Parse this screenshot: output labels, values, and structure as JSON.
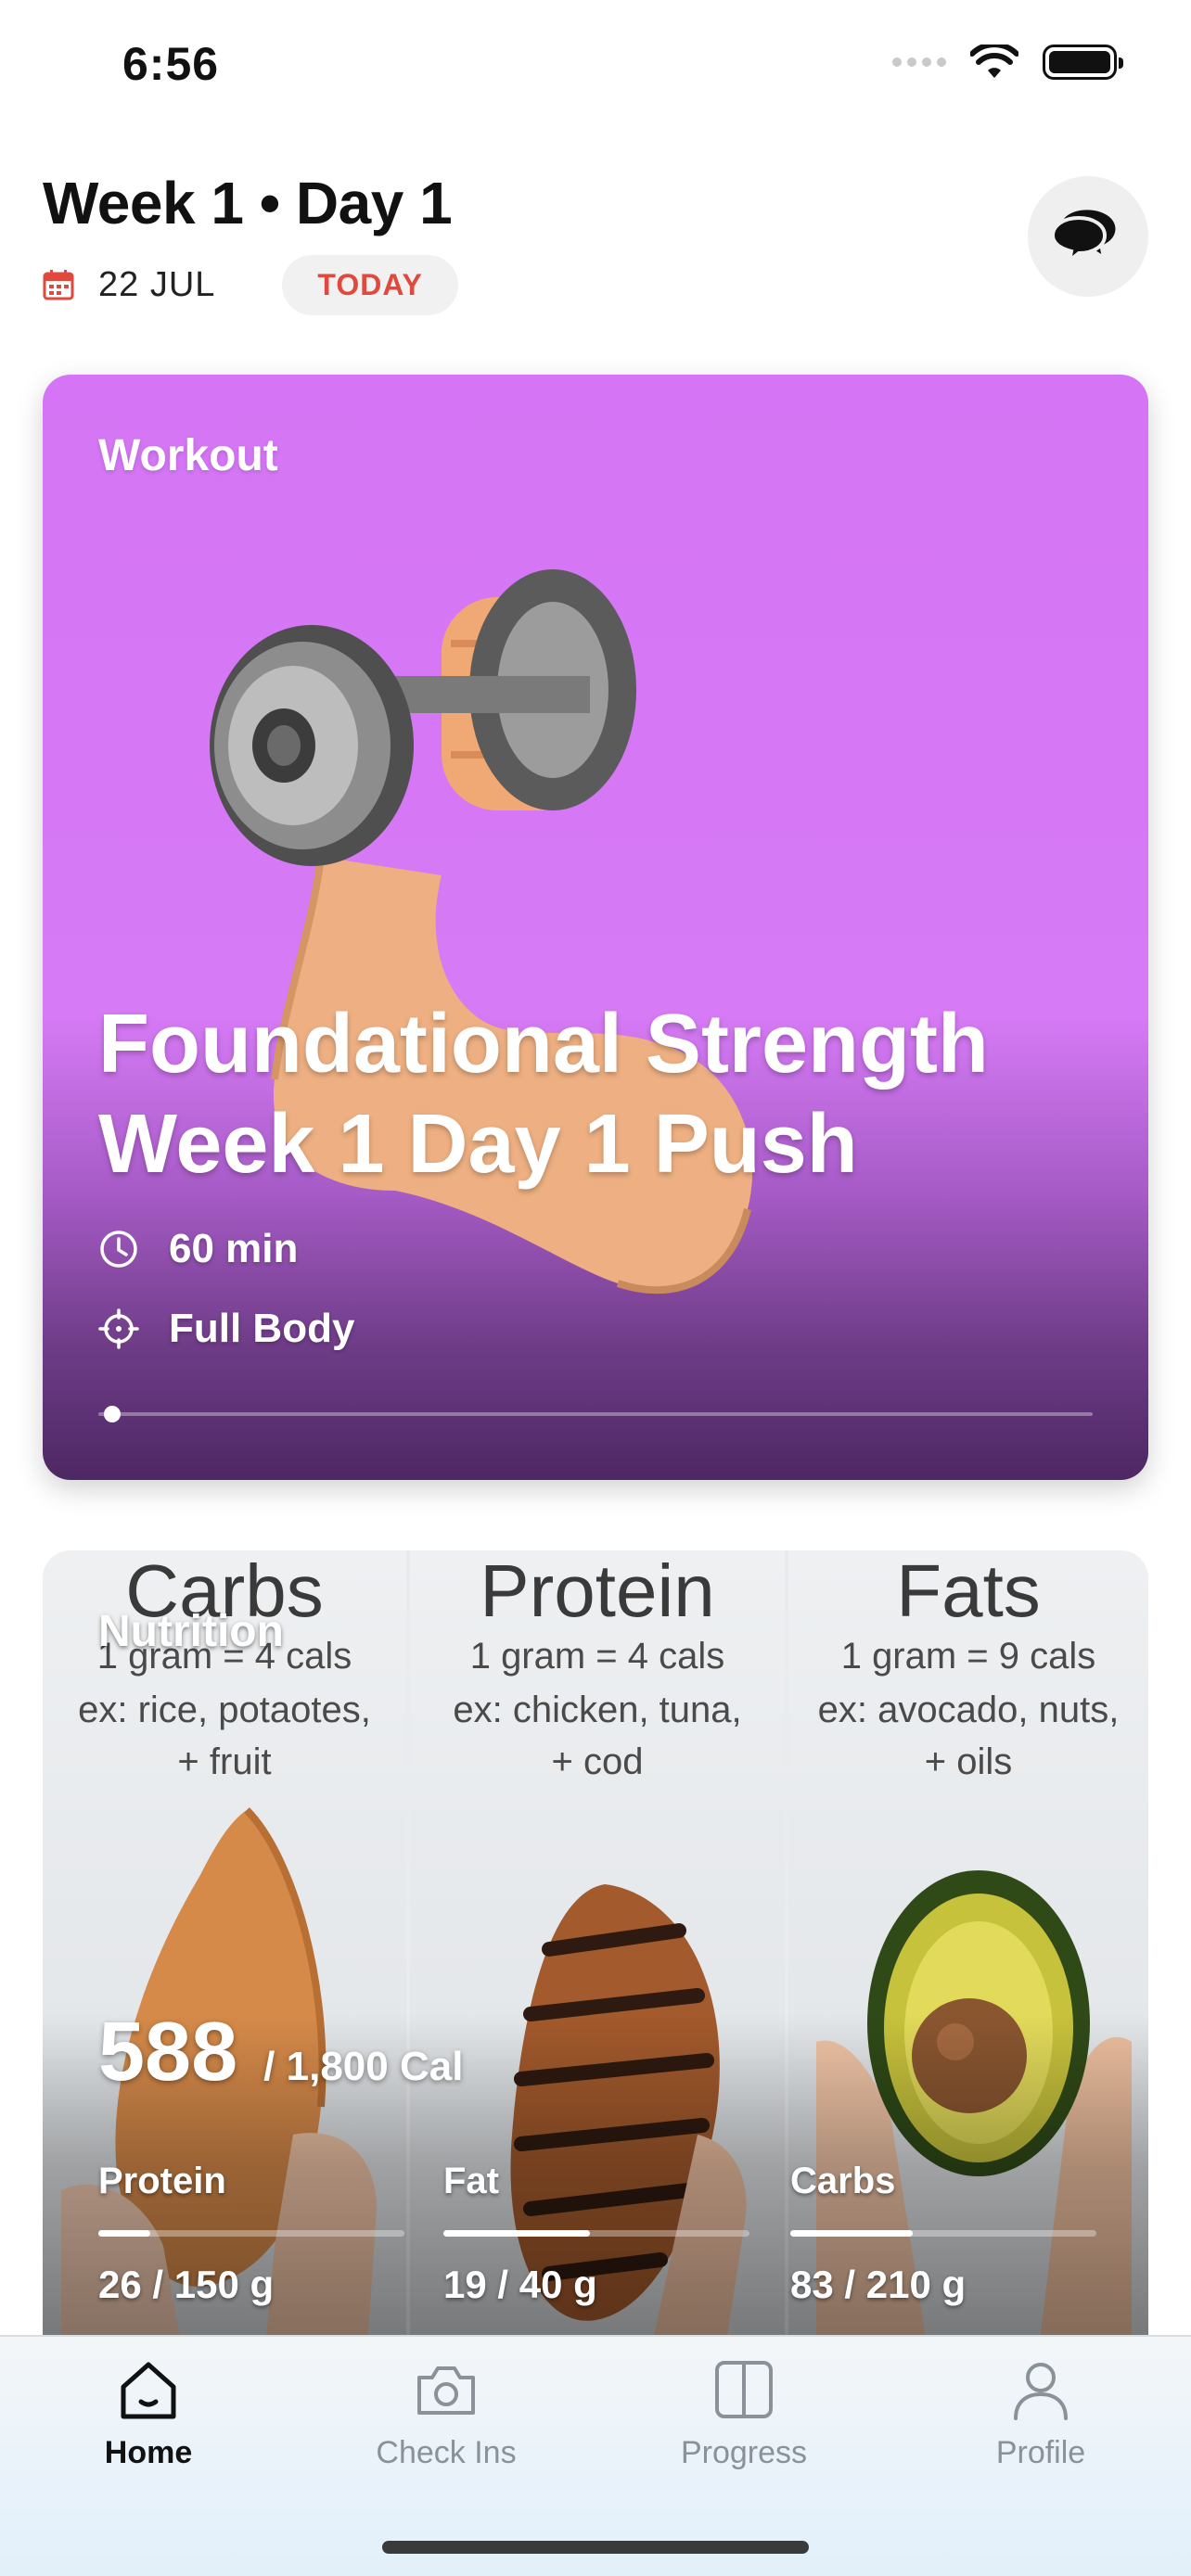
{
  "status_bar": {
    "time": "6:56"
  },
  "header": {
    "title": "Week 1 • Day 1",
    "date": "22 JUL",
    "badge": "TODAY"
  },
  "workout": {
    "label": "Workout",
    "title": "Foundational Strength Week 1 Day 1 Push",
    "duration": "60 min",
    "focus": "Full Body",
    "progress_percent": 1
  },
  "nutrition": {
    "label": "Nutrition",
    "calories_consumed": "588",
    "calories_goal": "/ 1,800 Cal",
    "image_columns": [
      {
        "heading": "Carbs",
        "line1": "1 gram = 4 cals",
        "line2": "ex: rice, potaotes,",
        "line3": "+ fruit"
      },
      {
        "heading": "Protein",
        "line1": "1 gram = 4 cals",
        "line2": "ex: chicken, tuna,",
        "line3": "+ cod"
      },
      {
        "heading": "Fats",
        "line1": "1 gram = 9 cals",
        "line2": "ex: avocado, nuts,",
        "line3": "+ oils"
      }
    ],
    "macros": [
      {
        "name": "Protein",
        "amount": "26 / 150 g",
        "fraction": 0.17
      },
      {
        "name": "Fat",
        "amount": "19 / 40 g",
        "fraction": 0.48
      },
      {
        "name": "Carbs",
        "amount": "83 / 210 g",
        "fraction": 0.4
      }
    ]
  },
  "tabs": [
    {
      "label": "Home",
      "icon": "home-icon",
      "active": true
    },
    {
      "label": "Check Ins",
      "icon": "camera-icon",
      "active": false
    },
    {
      "label": "Progress",
      "icon": "split-panel-icon",
      "active": false
    },
    {
      "label": "Profile",
      "icon": "person-icon",
      "active": false
    }
  ],
  "colors": {
    "accent_red": "#e0493d",
    "workout_card": "#d575f5",
    "workout_card_dark": "#4d2763"
  }
}
